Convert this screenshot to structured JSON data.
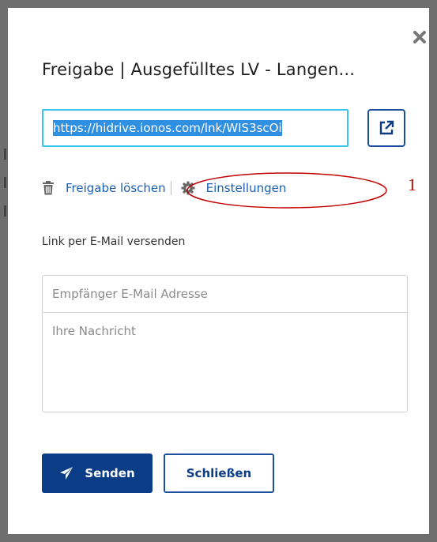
{
  "dialog": {
    "title": "Freigabe | Ausgefülltes LV - Langen...",
    "share_url": "https://hidrive.ionos.com/lnk/WIS3scOi",
    "actions": {
      "delete_label": "Freigabe löschen",
      "settings_label": "Einstellungen"
    },
    "annotation_number": "1",
    "email_section": {
      "label": "Link per E-Mail versenden",
      "recipient_placeholder": "Empfänger E-Mail Adresse",
      "message_placeholder": "Ihre Nachricht"
    },
    "buttons": {
      "send_label": "Senden",
      "close_label": "Schließen"
    }
  },
  "colors": {
    "primary": "#0b3d86",
    "link": "#1a5fb4",
    "focus_border": "#3ac5f0",
    "selection": "#2f8fe0",
    "annotation": "#c00000"
  },
  "icons": [
    "close-icon",
    "external-link-icon",
    "trash-icon",
    "gear-icon",
    "paper-plane-icon"
  ]
}
